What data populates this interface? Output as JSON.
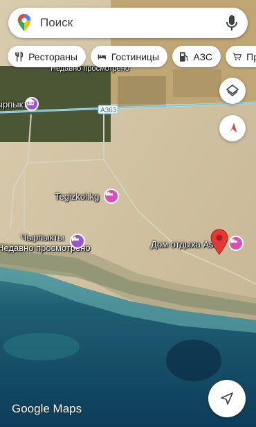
{
  "search": {
    "placeholder": "Поиск"
  },
  "chips": [
    {
      "label": "Рестораны",
      "icon": "fork-knife-icon"
    },
    {
      "label": "Гостиницы",
      "icon": "bed-icon"
    },
    {
      "label": "АЗС",
      "icon": "gas-station-icon"
    },
    {
      "label": "Пр",
      "icon": "shopping-cart-icon"
    }
  ],
  "map": {
    "road_shield": "A363",
    "labels": {
      "recent_top": "Недавно просмотрено",
      "town_top": "Чырпыкты",
      "tegizkol": "Tegizkol.kg",
      "chyrpykty": "Чырпыкты",
      "recent_bottom": "Недавно просмотрено",
      "dom_otdyha": "Дом отдыха As"
    }
  },
  "attribution": "Google Maps",
  "colors": {
    "poi_pink": "#d84fb8",
    "poi_purple": "#9a57c9",
    "route_blue": "#6fc8ea",
    "pin_red": "#e53935"
  }
}
